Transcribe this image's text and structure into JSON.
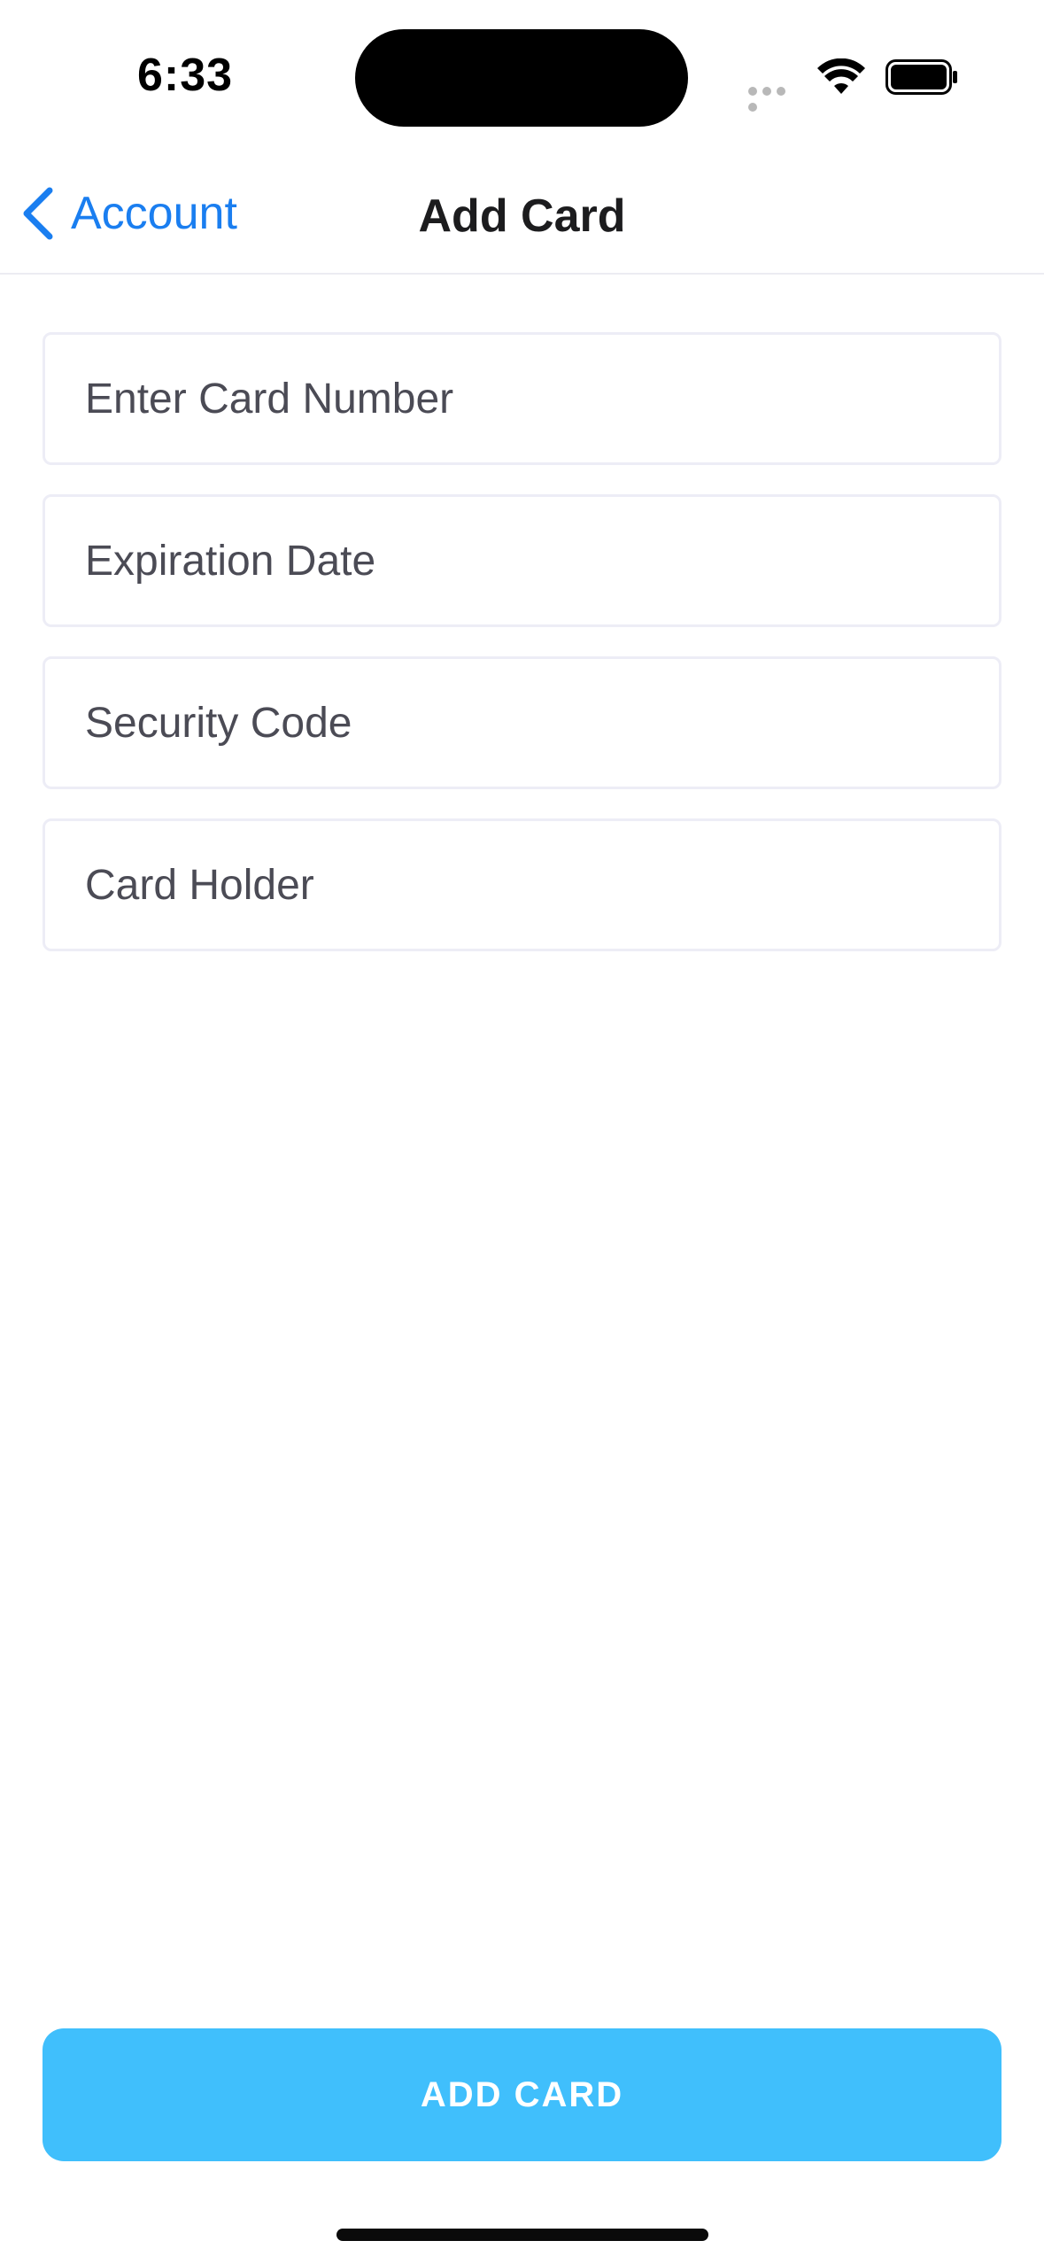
{
  "status_bar": {
    "time": "6:33"
  },
  "nav": {
    "back_label": "Account",
    "title": "Add Card"
  },
  "form": {
    "card_number": {
      "placeholder": "Enter Card Number",
      "value": ""
    },
    "expiration_date": {
      "placeholder": "Expiration Date",
      "value": ""
    },
    "security_code": {
      "placeholder": "Security Code",
      "value": ""
    },
    "card_holder": {
      "placeholder": "Card Holder",
      "value": ""
    }
  },
  "actions": {
    "add_card_label": "ADD CARD"
  },
  "colors": {
    "accent_blue": "#1a7ef0",
    "button_blue": "#40bffc",
    "field_border": "#ededf6"
  },
  "icons": {
    "back": "chevron-left-icon",
    "wifi": "wifi-icon",
    "battery": "battery-icon",
    "signal": "cellular-signal-icon"
  }
}
